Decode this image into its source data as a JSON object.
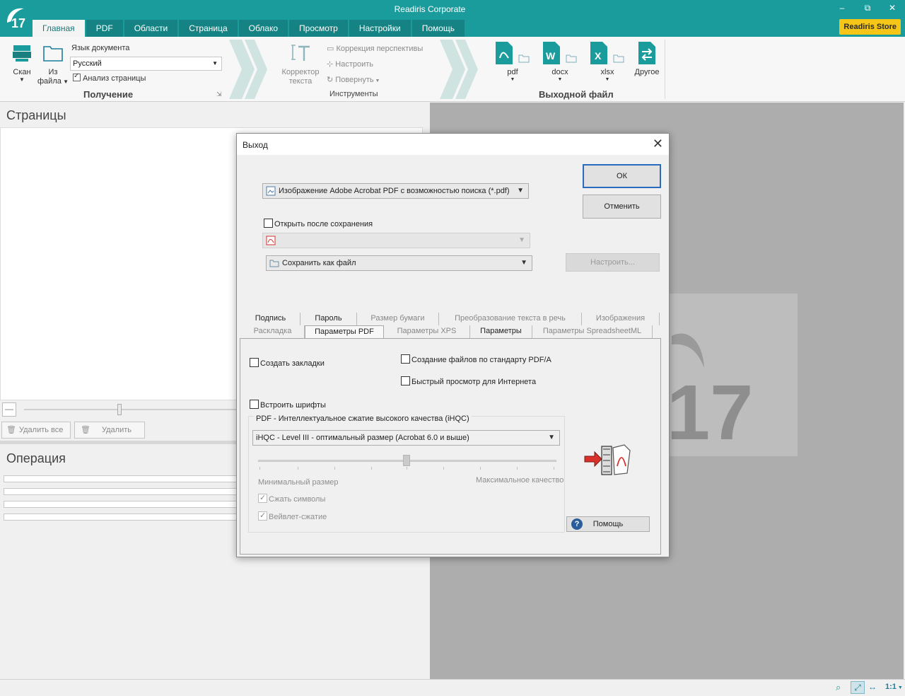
{
  "app": {
    "title": "Readiris Corporate",
    "logo_text": "17",
    "store_button": "Readiris Store",
    "window_controls": [
      "–",
      "⧉",
      "✕"
    ]
  },
  "menu_tabs": [
    "Главная",
    "PDF",
    "Области",
    "Страница",
    "Облако",
    "Просмотр",
    "Настройки",
    "Помощь"
  ],
  "active_menu_tab": "Главная",
  "ribbon": {
    "scan_label": "Скан",
    "from_file_label_1": "Из",
    "from_file_label_2": "файла",
    "doc_language_label": "Язык документа",
    "doc_language_value": "Русский",
    "page_analysis_label": "Анализ страницы",
    "acquire_group": "Получение",
    "text_corrector_1": "Корректор",
    "text_corrector_2": "текста",
    "perspective": "Коррекция перспективы",
    "configure": "Настроить",
    "rotate": "Повернуть",
    "tools_group": "Инструменты",
    "out_pdf": "pdf",
    "out_docx": "docx",
    "out_xlsx": "xlsx",
    "out_other": "Другое",
    "output_group": "Выходной файл"
  },
  "left_panel": {
    "pages_title": "Страницы",
    "delete_all": "Удалить все",
    "delete": "Удалить",
    "operation_title": "Операция"
  },
  "dialog": {
    "title": "Выход",
    "format_value": "Изображение Adobe Acrobat PDF с возможностью поиска (*.pdf)",
    "open_after_save": "Открыть после сохранения",
    "save_as_value": "Сохранить как файл",
    "ok": "ОК",
    "cancel": "Отменить",
    "configure": "Настроить...",
    "tabs_row1": [
      "Подпись",
      "Пароль",
      "Размер бумаги",
      "Преобразование текста в речь",
      "Изображения"
    ],
    "tabs_row2": [
      "Раскладка",
      "Параметры PDF",
      "Параметры XPS",
      "Параметры",
      "Параметры SpreadsheetML"
    ],
    "active_tab": "Параметры PDF",
    "create_bookmarks": "Создать закладки",
    "pdfa": "Создание файлов по стандарту PDF/A",
    "fast_web_view": "Быстрый просмотр для Интернета",
    "embed_fonts": "Встроить шрифты",
    "ihqc_group": "PDF - Интеллектуальное сжатие высокого качества (iHQC)",
    "ihqc_value": "iHQC - Level III - оптимальный размер (Acrobat 6.0 и выше)",
    "min_size": "Минимальный размер",
    "max_quality": "Максимальное качество",
    "compress_symbols": "Сжать символы",
    "wavelet": "Вейвлет-сжатие",
    "help": "Помощь"
  },
  "status": {
    "zoom_ratio": "1:1"
  },
  "colors": {
    "teal": "#1a9c9c",
    "store_yellow": "#f5c518",
    "pdf_red": "#d9302b",
    "word_blue": "#1a7fb8",
    "excel_green": "#1f7a45"
  }
}
